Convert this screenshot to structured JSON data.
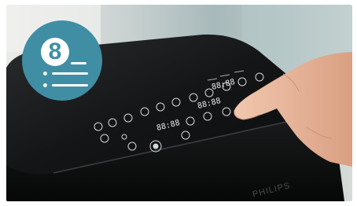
{
  "badge": {
    "step_number": "8",
    "color": "#3f8ea4"
  },
  "device": {
    "brand_text": "PHILIPS",
    "body_color": "#121314",
    "display_color": "#e8eef0",
    "display_digits": [
      "88:88",
      "88:88",
      "88:88"
    ]
  },
  "scene": {
    "background_color": "#b8c6c4",
    "hand_color": "#e8b89c"
  }
}
